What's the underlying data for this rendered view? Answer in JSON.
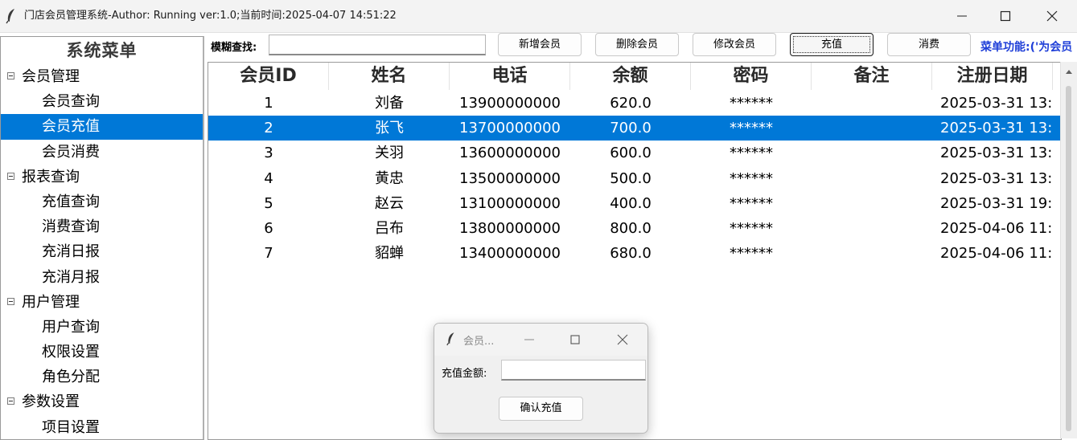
{
  "window": {
    "title": "门店会员管理系统-Author: Running  ver:1.0;当前时间:2025-04-07 14:51:22",
    "app_icon": "feather-icon",
    "controls": [
      "minimize-icon",
      "maximize-icon",
      "close-icon"
    ]
  },
  "sidebar": {
    "title": "系统菜单",
    "groups": [
      {
        "label": "会员管理",
        "items": [
          {
            "label": "会员查询"
          },
          {
            "label": "会员充值",
            "selected": true
          },
          {
            "label": "会员消费"
          }
        ]
      },
      {
        "label": "报表查询",
        "items": [
          {
            "label": "充值查询"
          },
          {
            "label": "消费查询"
          },
          {
            "label": "充消日报"
          },
          {
            "label": "充消月报"
          }
        ]
      },
      {
        "label": "用户管理",
        "items": [
          {
            "label": "用户查询"
          },
          {
            "label": "权限设置"
          },
          {
            "label": "角色分配"
          }
        ]
      },
      {
        "label": "参数设置",
        "items": [
          {
            "label": "项目设置"
          }
        ]
      }
    ]
  },
  "toolbar": {
    "search_label": "模糊查找:",
    "search_value": "",
    "buttons": {
      "add": "新增会员",
      "delete": "删除会员",
      "edit": "修改会员",
      "recharge": "充值",
      "consume": "消费"
    },
    "menu_function_text": "菜单功能:('为会员"
  },
  "table": {
    "columns": [
      "会员ID",
      "姓名",
      "电话",
      "余额",
      "密码",
      "备注",
      "注册日期"
    ],
    "rows": [
      [
        "1",
        "刘备",
        "13900000000",
        "620.0",
        "******",
        "",
        "2025-03-31 13:"
      ],
      [
        "2",
        "张飞",
        "13700000000",
        "700.0",
        "******",
        "",
        "2025-03-31 13:"
      ],
      [
        "3",
        "关羽",
        "13600000000",
        "600.0",
        "******",
        "",
        "2025-03-31 13:"
      ],
      [
        "4",
        "黄忠",
        "13500000000",
        "500.0",
        "******",
        "",
        "2025-03-31 13:"
      ],
      [
        "5",
        "赵云",
        "13100000000",
        "400.0",
        "******",
        "",
        "2025-03-31 19:"
      ],
      [
        "6",
        "吕布",
        "13800000000",
        "800.0",
        "******",
        "",
        "2025-04-06 11:"
      ],
      [
        "7",
        "貂蝉",
        "13400000000",
        "680.0",
        "******",
        "",
        "2025-04-06 11:"
      ]
    ],
    "selected_row": 1
  },
  "dialog": {
    "title": "会员...",
    "amount_label": "充值金额:",
    "amount_value": "",
    "confirm_label": "确认充值"
  },
  "colors": {
    "selection": "#0078d7",
    "menu_function_text": "#1f3fd8"
  }
}
